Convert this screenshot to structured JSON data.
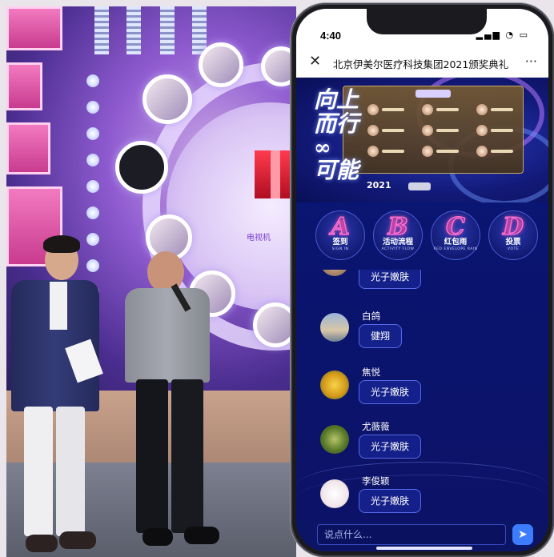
{
  "phone": {
    "status_time": "4:40",
    "status_icons": "▂▄▆ ◔ ▭",
    "nav_title": "北京伊美尔医疗科技集团2021颁奖典礼",
    "close_icon": "close-icon",
    "more_icon": "more-icon",
    "banner": {
      "line1": "向上",
      "line2": "而行",
      "line3": "∞",
      "line4": "可能",
      "year": "2021"
    },
    "menu": [
      {
        "glyph": "A",
        "label": "签到",
        "sub": "SIGN IN"
      },
      {
        "glyph": "B",
        "label": "活动流程",
        "sub": "ACTIVITY FLOW"
      },
      {
        "glyph": "C",
        "label": "红包雨",
        "sub": "RED ENVELOPE RAIN"
      },
      {
        "glyph": "D",
        "label": "投票",
        "sub": "VOTE"
      }
    ],
    "messages": [
      {
        "name": "",
        "text": "光子嫩肤"
      },
      {
        "name": "白鸽",
        "text": "健翔"
      },
      {
        "name": "焦悦",
        "text": "光子嫩肤"
      },
      {
        "name": "尤薇薇",
        "text": "光子嫩肤"
      },
      {
        "name": "李俊颖",
        "text": "光子嫩肤"
      }
    ],
    "composer": {
      "placeholder": "说点什么..."
    }
  },
  "stage": {
    "screen_caption": "电视机"
  },
  "colors": {
    "accent": "#ff6fd1",
    "bg_blue": "#0f1f8e",
    "send": "#3c7dff"
  }
}
